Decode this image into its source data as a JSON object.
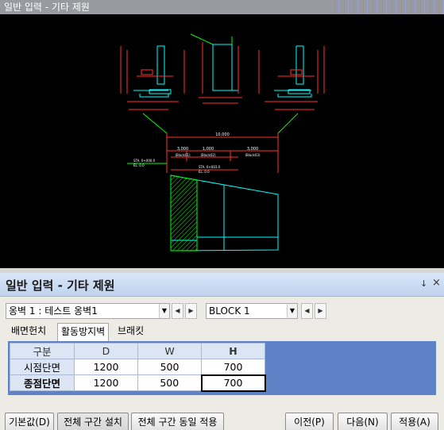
{
  "viewport": {
    "title": "일반 입력 - 기타 제원",
    "drawing": {
      "plan_dimension": "10,000",
      "segment_dims": [
        "3,000",
        "1,000",
        "3,000"
      ],
      "segment_labels": [
        "(Block01)",
        "(Block02)",
        "(Block03)"
      ],
      "station_labels": [
        "STA. 0+000.0",
        "STA. 0+003.0"
      ],
      "elevation_labels": [
        "EL. 0.0",
        "EL. 0.0"
      ]
    }
  },
  "panel": {
    "title": "일반 입력 - 기타 제원",
    "pin": "↓",
    "close": "×"
  },
  "selectors": {
    "wall": "옹벽 1 : 테스트 옹벽1",
    "block": "BLOCK  1"
  },
  "tabs": [
    "배면헌치",
    "활동방지벽",
    "브래킷"
  ],
  "table": {
    "headers": [
      "구분",
      "D",
      "W",
      "H"
    ],
    "rows": [
      {
        "label": "시점단면",
        "values": [
          "1200",
          "500",
          "700"
        ]
      },
      {
        "label": "종점단면",
        "values": [
          "1200",
          "500",
          "700"
        ]
      }
    ]
  },
  "buttons": {
    "default": "기본값(D)",
    "apply_all": "전체 구간 설치",
    "same_all": "전체 구간 동일 적용",
    "prev": "이전(P)",
    "next": "다음(N)",
    "apply": "적용(A)"
  },
  "colors": {
    "canvas": "#000000",
    "section_lines": "#00ffff",
    "dimension_red": "#ff3030",
    "hatch_green": "#00ff00",
    "tab_grid_accent": "#5f82c6"
  }
}
